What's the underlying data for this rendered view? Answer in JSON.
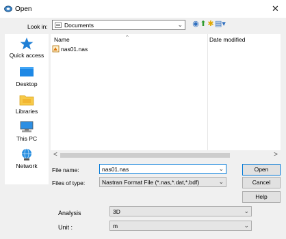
{
  "window": {
    "title": "Open",
    "close_glyph": "✕"
  },
  "lookin": {
    "label": "Look in:",
    "value": "Documents",
    "chevron": "⌄"
  },
  "toolbar": {
    "back_glyph": "◉",
    "up_glyph": "⬆",
    "newfolder_glyph": "✱",
    "views_glyph": "▤▾"
  },
  "places": [
    {
      "label": "Quick access"
    },
    {
      "label": "Desktop"
    },
    {
      "label": "Libraries"
    },
    {
      "label": "This PC"
    },
    {
      "label": "Network"
    }
  ],
  "filelist": {
    "sort_glyph": "^",
    "columns": {
      "name": "Name",
      "date": "Date modified"
    },
    "files": [
      {
        "name": "nas01.nas"
      }
    ]
  },
  "scrollbar": {
    "left": "<",
    "right": ">"
  },
  "filename": {
    "label": "File name:",
    "value": "nas01.nas",
    "chevron": "⌄"
  },
  "filetype": {
    "label": "Files of type:",
    "value": "Nastran Format File (*.nas,*.dat,*.bdf)",
    "chevron": "⌄"
  },
  "buttons": {
    "open": "Open",
    "cancel": "Cancel",
    "help": "Help"
  },
  "analysis": {
    "label": "Analysis",
    "value": "3D",
    "chevron": "⌄"
  },
  "unit": {
    "label": "Unit :",
    "value": "m",
    "chevron": "⌄"
  },
  "colors": {
    "accent": "#0078d7",
    "folder": "#f7c948"
  }
}
